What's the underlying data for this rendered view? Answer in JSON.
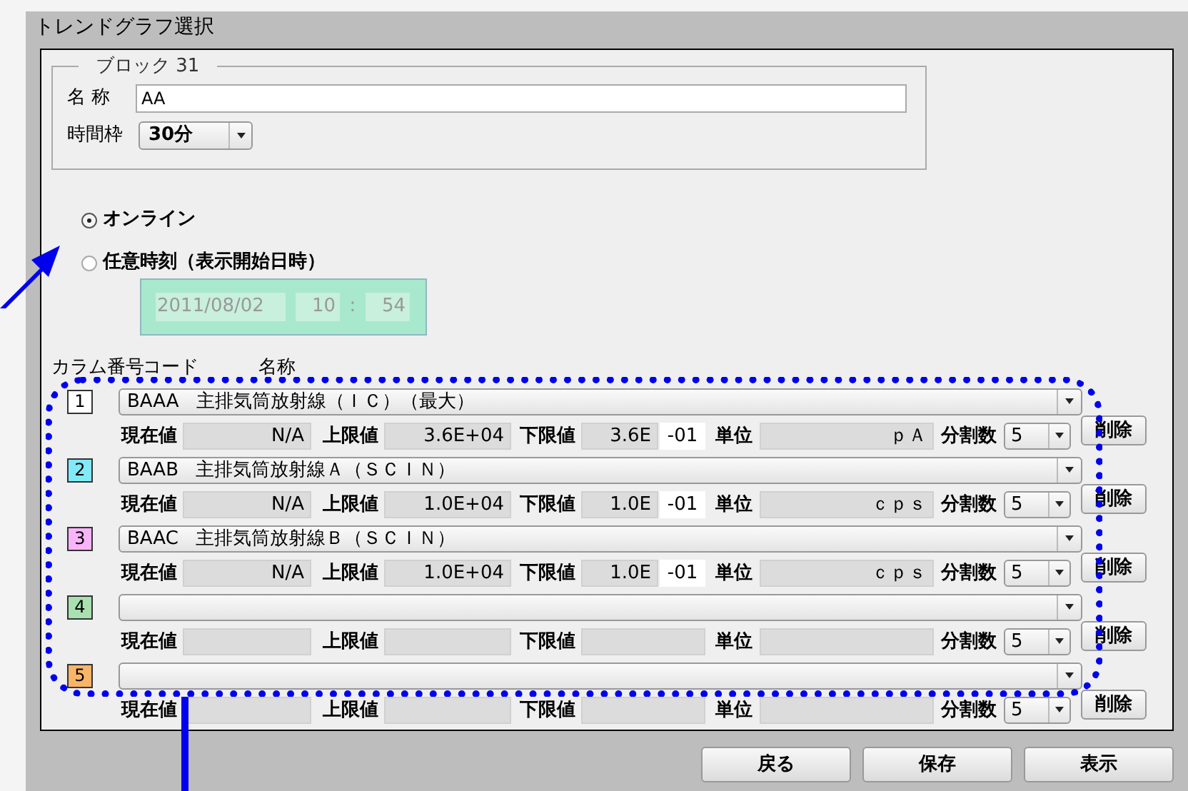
{
  "window": {
    "title": "トレンドグラフ選択"
  },
  "block": {
    "legend": "ブロック 31",
    "name_label": "名 称",
    "name_value": "AA",
    "timeframe_label": "時間枠",
    "timeframe_value": "30分"
  },
  "mode_options": [
    {
      "label": "オンライン",
      "selected": true
    },
    {
      "label": "任意時刻（表示開始日時）",
      "selected": false
    }
  ],
  "start_time": {
    "date": "2011/08/02",
    "hour": "10",
    "separator": ":",
    "minute": "54"
  },
  "column_headers": [
    "カラム番号",
    "コード",
    "名称"
  ],
  "channels": [
    {
      "number": "1",
      "color": "#ffffff",
      "code": "BAAA",
      "name": "主排気筒放射線（ＩＣ）（最大）",
      "current_label": "現在値",
      "current": "N/A",
      "upper_label": "上限値",
      "upper": "3.6E+04",
      "lower_label": "下限値",
      "lower_mantissa": "3.6E",
      "lower_exponent": "-01",
      "unit_label": "単位",
      "unit": "ｐＡ",
      "divisions_label": "分割数",
      "divisions": "5",
      "delete": "削除"
    },
    {
      "number": "2",
      "color": "#80eaf8",
      "code": "BAAB",
      "name": "主排気筒放射線Ａ（ＳＣＩＮ）",
      "current_label": "現在値",
      "current": "N/A",
      "upper_label": "上限値",
      "upper": "1.0E+04",
      "lower_label": "下限値",
      "lower_mantissa": "1.0E",
      "lower_exponent": "-01",
      "unit_label": "単位",
      "unit": "ｃｐｓ",
      "divisions_label": "分割数",
      "divisions": "5",
      "delete": "削除"
    },
    {
      "number": "3",
      "color": "#f8b4f8",
      "code": "BAAC",
      "name": "主排気筒放射線Ｂ（ＳＣＩＮ）",
      "current_label": "現在値",
      "current": "N/A",
      "upper_label": "上限値",
      "upper": "1.0E+04",
      "lower_label": "下限値",
      "lower_mantissa": "1.0E",
      "lower_exponent": "-01",
      "unit_label": "単位",
      "unit": "ｃｐｓ",
      "divisions_label": "分割数",
      "divisions": "5",
      "delete": "削除"
    },
    {
      "number": "4",
      "color": "#a8e0b0",
      "current_label": "現在値",
      "upper_label": "上限値",
      "lower_label": "下限値",
      "unit_label": "単位",
      "divisions_label": "分割数",
      "divisions": "5",
      "delete": "削除"
    },
    {
      "number": "5",
      "color": "#f8b468",
      "current_label": "現在値",
      "upper_label": "上限値",
      "lower_label": "下限値",
      "unit_label": "単位",
      "divisions_label": "分割数",
      "divisions": "5",
      "delete": "削除"
    }
  ],
  "buttons": [
    "戻る",
    "保存",
    "表示"
  ]
}
